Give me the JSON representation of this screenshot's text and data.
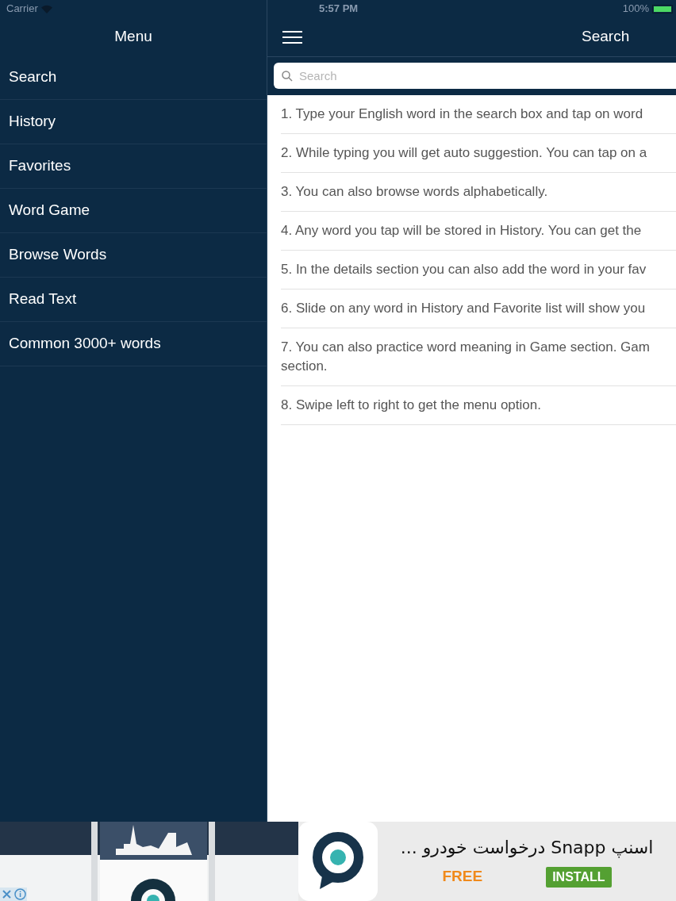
{
  "status_bar": {
    "carrier": "Carrier",
    "time": "5:57 PM",
    "battery": "100%"
  },
  "sidebar": {
    "title": "Menu",
    "items": [
      "Search",
      "History",
      "Favorites",
      "Word Game",
      "Browse Words",
      "Read Text",
      "Common 3000+ words"
    ]
  },
  "main": {
    "title": "Search",
    "search": {
      "placeholder": "Search"
    },
    "tips": [
      {
        "lines": [
          "1. Type your English word in the search box and tap on word"
        ]
      },
      {
        "lines": [
          "2. While typing you will get auto suggestion. You can tap on a"
        ]
      },
      {
        "lines": [
          "3. You can also browse words alphabetically."
        ]
      },
      {
        "lines": [
          "4. Any word you tap will be stored in History. You can get the"
        ]
      },
      {
        "lines": [
          "5. In the details section you can also add the word in your fav"
        ]
      },
      {
        "lines": [
          "6. Slide on any word in History and Favorite list will show you"
        ]
      },
      {
        "lines": [
          "7. You can also practice word meaning in Game section. Gam",
          "section."
        ]
      },
      {
        "lines": [
          "8. Swipe left to right to get the menu option."
        ]
      }
    ]
  },
  "ad": {
    "title": "اسنپ Snapp درخواست خودرو ...",
    "price": "FREE",
    "button": "INSTALL"
  }
}
